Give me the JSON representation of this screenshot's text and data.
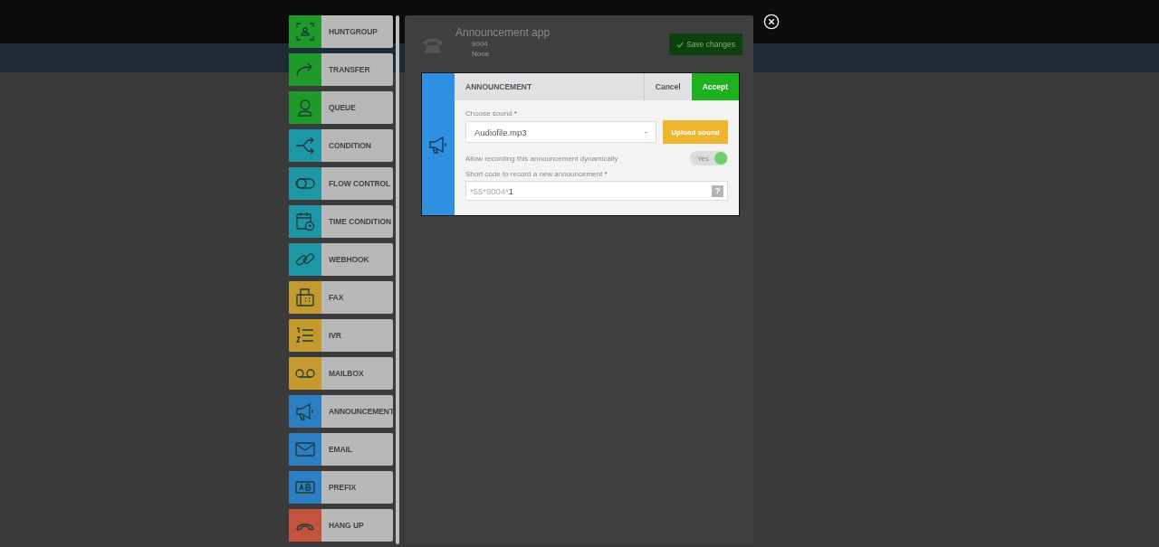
{
  "palette": [
    {
      "label": "HUNTGROUP",
      "color": "#1f9a2a"
    },
    {
      "label": "TRANSFER",
      "color": "#1f9a2a"
    },
    {
      "label": "QUEUE",
      "color": "#1f9a2a"
    },
    {
      "label": "CONDITION",
      "color": "#1d97a6"
    },
    {
      "label": "FLOW CONTROL",
      "color": "#1d97a6"
    },
    {
      "label": "TIME CONDITION",
      "color": "#1d97a6"
    },
    {
      "label": "WEBHOOK",
      "color": "#1d97a6"
    },
    {
      "label": "FAX",
      "color": "#c49a2e"
    },
    {
      "label": "IVR",
      "color": "#c49a2e"
    },
    {
      "label": "MAILBOX",
      "color": "#c49a2e"
    },
    {
      "label": "ANNOUNCEMENT",
      "color": "#2c7fc2"
    },
    {
      "label": "EMAIL",
      "color": "#2c7fc2"
    },
    {
      "label": "PREFIX",
      "color": "#2c7fc2"
    },
    {
      "label": "HANG UP",
      "color": "#c2533d"
    }
  ],
  "app": {
    "title": "Announcement app",
    "number": "9004",
    "target": "None",
    "save": "Save changes"
  },
  "dialog": {
    "title": "ANNOUNCEMENT",
    "cancel": "Cancel",
    "accept": "Accept",
    "sound_label": "Choose sound",
    "sound_value": "Audiofile.mp3",
    "upload": "Upload sound",
    "toggle_label": "Allow recording this announcement dynamically",
    "toggle_text": "Yes",
    "toggle_on": true,
    "code_label": "Short code to record a new announcement",
    "code_prefix": "*55*9004*",
    "code_value": "1",
    "help": "?",
    "required": "*"
  }
}
